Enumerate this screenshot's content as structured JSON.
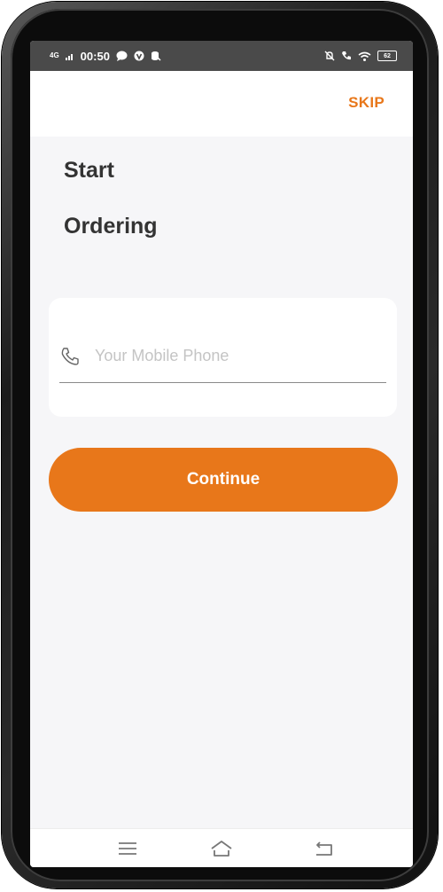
{
  "status_bar": {
    "network": "4G",
    "time": "00:50",
    "battery": "62"
  },
  "header": {
    "skip_label": "SKIP"
  },
  "title": {
    "line1": "Start",
    "line2": "Ordering"
  },
  "phone_input": {
    "placeholder": "Your Mobile Phone",
    "value": "",
    "icon": "phone-icon"
  },
  "continue_button": {
    "label": "Continue"
  },
  "nav_bar": {
    "icons": [
      "menu-icon",
      "home-icon",
      "back-icon"
    ]
  },
  "colors": {
    "accent": "#e8771a",
    "background": "#f6f6f8",
    "title": "#333333"
  }
}
